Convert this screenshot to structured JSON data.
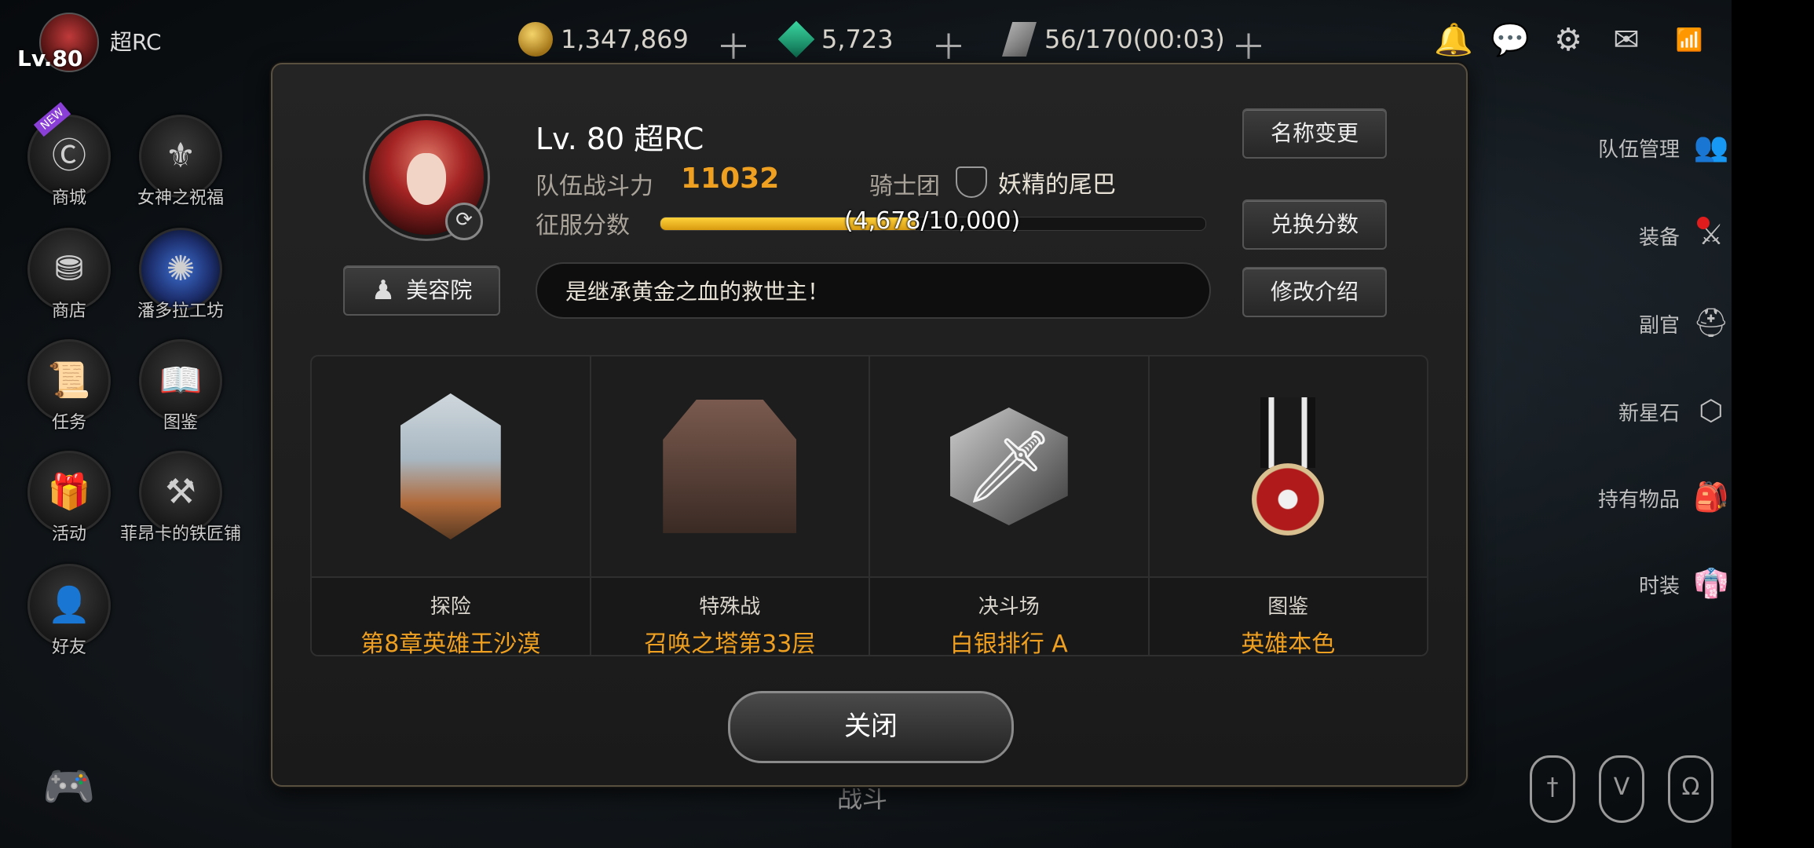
{
  "hud": {
    "level": "Lv.80",
    "player_name": "超RC",
    "gold": "1,347,869",
    "gems": "5,723",
    "stamina": "56/170(00:03)"
  },
  "left_menu": [
    {
      "label": "商城",
      "new": true
    },
    {
      "label": "女神之祝福"
    },
    {
      "label": "商店"
    },
    {
      "label": "潘多拉工坊"
    },
    {
      "label": "任务"
    },
    {
      "label": "图鉴"
    },
    {
      "label": "活动"
    },
    {
      "label": "菲昂卡的铁匠铺"
    },
    {
      "label": "好友"
    }
  ],
  "new_tag": "NEW",
  "right_menu": [
    "队伍管理",
    "装备",
    "副官",
    "新星石",
    "持有物品",
    "时装"
  ],
  "battle_label": "战斗",
  "profile": {
    "title": "Lv. 80 超RC",
    "power_label": "队伍战斗力",
    "power_value": "11032",
    "guild_label": "骑士团",
    "guild_name": "妖精的尾巴",
    "conquest_label": "征服分数",
    "conquest_text": "(4,678/10,000)",
    "conquest_current": 4678,
    "conquest_max": 10000,
    "intro": "是继承黄金之血的救世主！",
    "beauty_button": "美容院",
    "rename_button": "名称变更",
    "exchange_button": "兑换分数",
    "edit_intro_button": "修改介绍",
    "close_button": "关闭"
  },
  "cards": [
    {
      "title": "探险",
      "value": "第8章英雄王沙漠"
    },
    {
      "title": "特殊战",
      "value": "召唤之塔第33层"
    },
    {
      "title": "决斗场",
      "value": "白银排行 A"
    },
    {
      "title": "图鉴",
      "value": "英雄本色"
    }
  ],
  "colors": {
    "accent_orange": "#f0a020",
    "bar_yellow": "#ffd23a",
    "red_dot": "#e01c1c"
  }
}
